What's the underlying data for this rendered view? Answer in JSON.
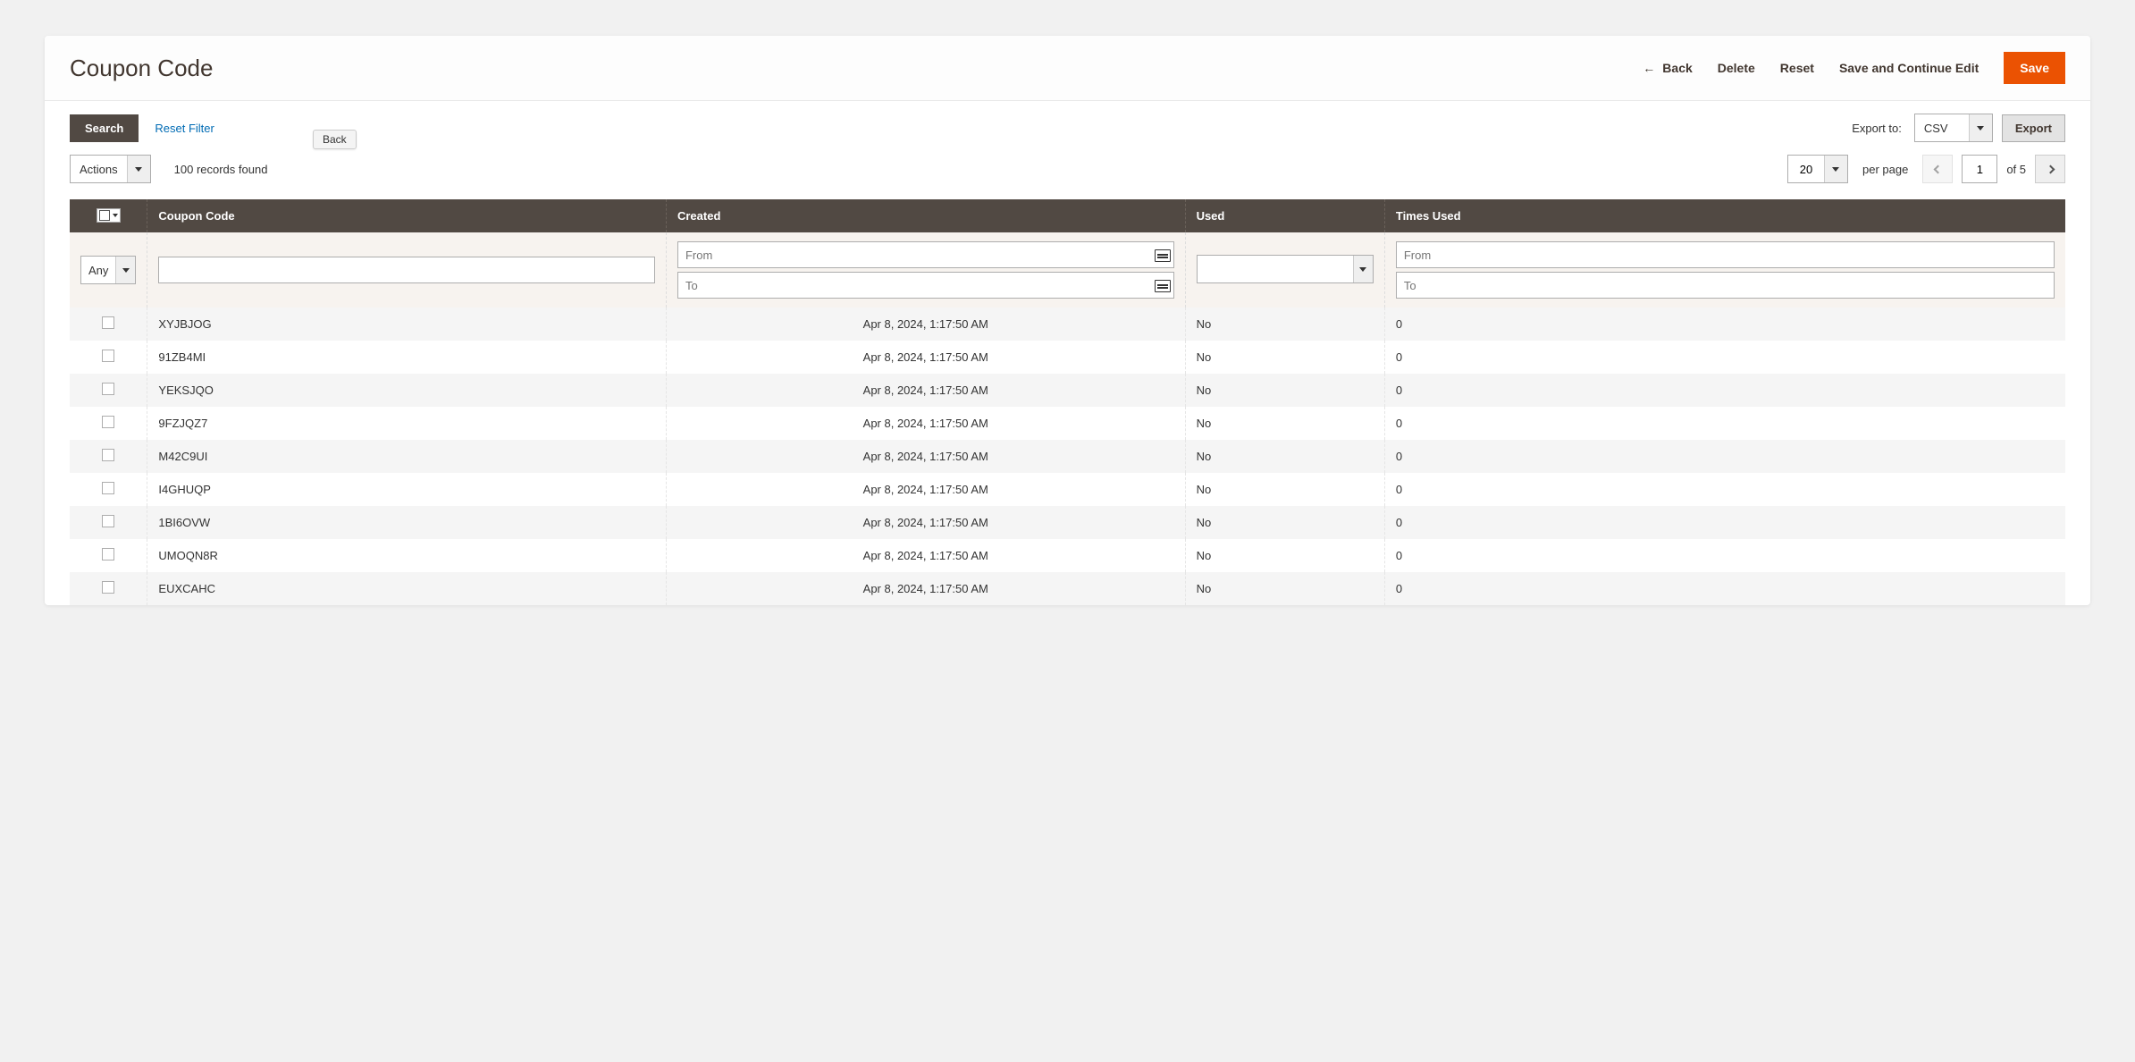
{
  "header": {
    "title": "Coupon Code",
    "back_label": "Back",
    "delete_label": "Delete",
    "reset_label": "Reset",
    "save_continue_label": "Save and Continue Edit",
    "save_label": "Save",
    "tooltip": "Back"
  },
  "toolbar": {
    "search_label": "Search",
    "reset_filter_label": "Reset Filter",
    "export_to_label": "Export to:",
    "export_format": "CSV",
    "export_button": "Export",
    "actions_label": "Actions",
    "records_found": "100 records found",
    "per_page_value": "20",
    "per_page_label": "per page",
    "page_current": "1",
    "page_total": "of 5"
  },
  "columns": {
    "code": "Coupon Code",
    "created": "Created",
    "used": "Used",
    "times": "Times Used"
  },
  "filters": {
    "any_label": "Any",
    "from_ph": "From",
    "to_ph": "To"
  },
  "rows": [
    {
      "code": "XYJBJOG",
      "created": "Apr 8, 2024, 1:17:50 AM",
      "used": "No",
      "times": "0"
    },
    {
      "code": "91ZB4MI",
      "created": "Apr 8, 2024, 1:17:50 AM",
      "used": "No",
      "times": "0"
    },
    {
      "code": "YEKSJQO",
      "created": "Apr 8, 2024, 1:17:50 AM",
      "used": "No",
      "times": "0"
    },
    {
      "code": "9FZJQZ7",
      "created": "Apr 8, 2024, 1:17:50 AM",
      "used": "No",
      "times": "0"
    },
    {
      "code": "M42C9UI",
      "created": "Apr 8, 2024, 1:17:50 AM",
      "used": "No",
      "times": "0"
    },
    {
      "code": "I4GHUQP",
      "created": "Apr 8, 2024, 1:17:50 AM",
      "used": "No",
      "times": "0"
    },
    {
      "code": "1BI6OVW",
      "created": "Apr 8, 2024, 1:17:50 AM",
      "used": "No",
      "times": "0"
    },
    {
      "code": "UMOQN8R",
      "created": "Apr 8, 2024, 1:17:50 AM",
      "used": "No",
      "times": "0"
    },
    {
      "code": "EUXCAHC",
      "created": "Apr 8, 2024, 1:17:50 AM",
      "used": "No",
      "times": "0"
    }
  ]
}
